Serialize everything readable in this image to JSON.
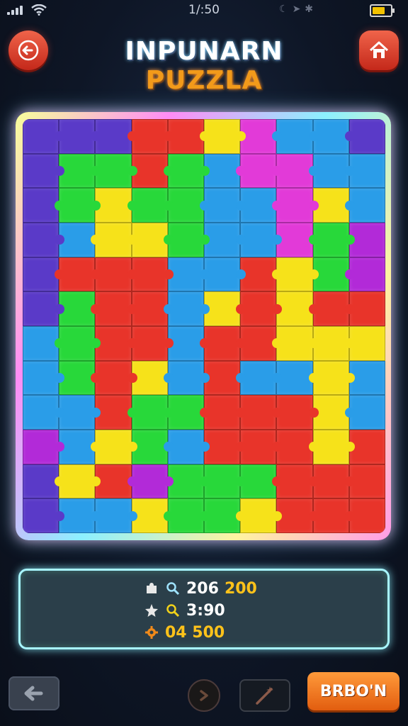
{
  "status_bar": {
    "time": "1/:50",
    "icons": [
      "cellular-signal-icon",
      "wifi-icon",
      "moon-icon",
      "location-icon",
      "bluetooth-icon",
      "battery-icon"
    ],
    "battery_level": 0.7
  },
  "header": {
    "title_part1": "INPUNARN",
    "title_part2": "PUZZLA",
    "back_icon": "back-arrow-icon",
    "home_icon": "home-icon"
  },
  "board": {
    "cols": 10,
    "rows": 12,
    "palette": {
      "R": "#e8342a",
      "G": "#28d83a",
      "B": "#2a9de8",
      "Y": "#f6e21a",
      "P": "#b22ad8",
      "M": "#e23ad8",
      "V": "#5a3ac8",
      "T": "#1ab89a"
    },
    "grid": [
      "VVVRRYMBBV",
      "VGGRGBMMBB",
      "VGYGGBBMYB",
      "VBYYGBBMGP",
      "VRRRBBRYGP",
      "VGRRBYRYRR",
      "BGRRBRRYYY",
      "BGRYBRBBYB",
      "BBRGGRRRYB",
      "PBYGBRRRYR",
      "VYRPGGGRRR",
      "VBBYGGYRRR"
    ]
  },
  "stats": [
    {
      "icon": "puzzle-piece-icon",
      "icon2": "magnifier-icon",
      "value": "206",
      "accent": "200"
    },
    {
      "icon": "star-icon",
      "icon2": "magnifier-icon",
      "value": "3:90",
      "accent": ""
    },
    {
      "icon": "cog-icon",
      "icon2": "",
      "value": "",
      "accent": "04 500"
    }
  ],
  "footer": {
    "undo_icon": "undo-arrow-icon",
    "hint_icon": "hint-circle-icon",
    "tool_icon": "magic-wand-icon",
    "play_label": "BRBO'N"
  }
}
